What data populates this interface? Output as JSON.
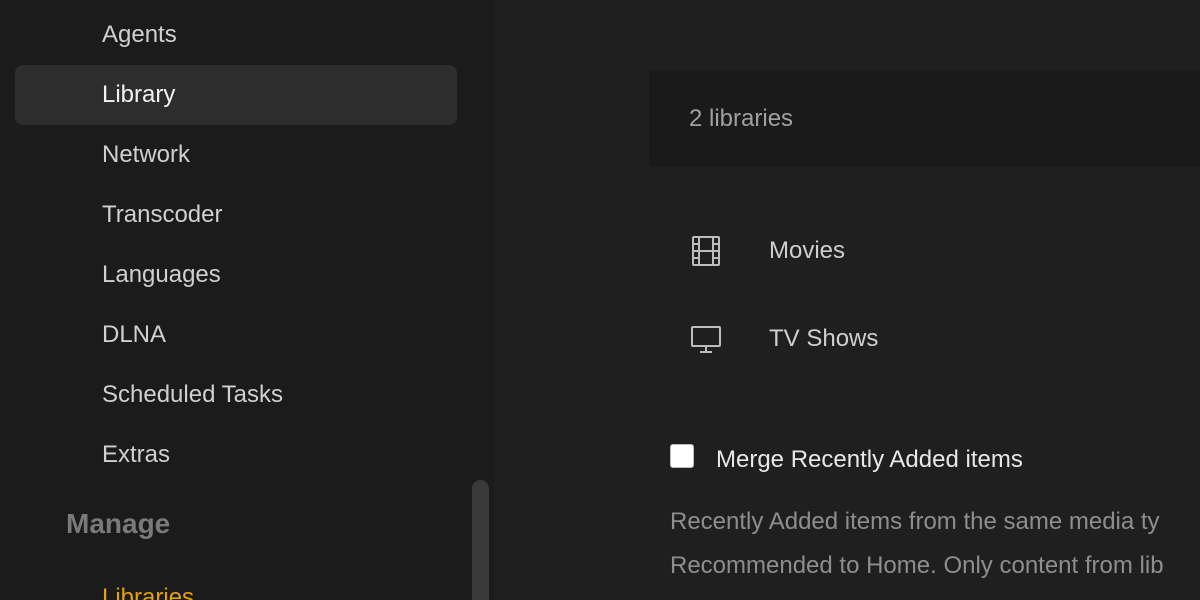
{
  "sidebar": {
    "items": [
      {
        "label": "Agents",
        "active": false
      },
      {
        "label": "Library",
        "active": true
      },
      {
        "label": "Network",
        "active": false
      },
      {
        "label": "Transcoder",
        "active": false
      },
      {
        "label": "Languages",
        "active": false
      },
      {
        "label": "DLNA",
        "active": false
      },
      {
        "label": "Scheduled Tasks",
        "active": false
      },
      {
        "label": "Extras",
        "active": false
      }
    ],
    "section_header": "Manage",
    "section_first_item": "Libraries"
  },
  "main": {
    "libraries_count": "2 libraries",
    "libraries": [
      {
        "label": "Movies",
        "icon": "film-icon"
      },
      {
        "label": "TV Shows",
        "icon": "tv-icon"
      }
    ],
    "merge_option": {
      "label": "Merge Recently Added items",
      "checked": false
    },
    "merge_help_lines": [
      "Recently Added items from the same media ty",
      "Recommended to Home. Only content from lib"
    ]
  },
  "colors": {
    "accent": "#e5a00d",
    "sidebar_bg": "#1b1b1b",
    "main_bg": "#1f1f1f",
    "active_item_bg": "#2d2d2d"
  }
}
